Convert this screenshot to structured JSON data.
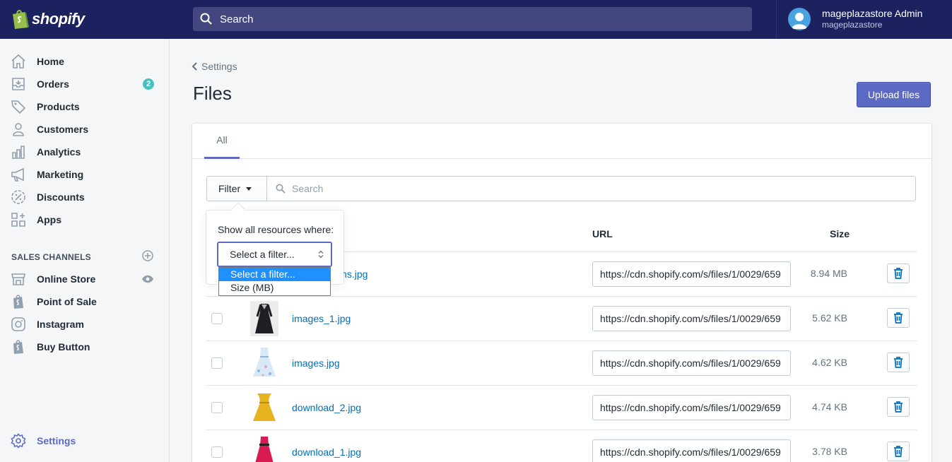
{
  "topbar": {
    "brand": "shopify",
    "search_placeholder": "Search",
    "user_name": "mageplazastore Admin",
    "store_name": "mageplazastore"
  },
  "sidebar": {
    "items": [
      {
        "label": "Home",
        "icon": "home-icon"
      },
      {
        "label": "Orders",
        "icon": "orders-icon",
        "badge": "2"
      },
      {
        "label": "Products",
        "icon": "tag-icon"
      },
      {
        "label": "Customers",
        "icon": "person-icon"
      },
      {
        "label": "Analytics",
        "icon": "bar-chart-icon"
      },
      {
        "label": "Marketing",
        "icon": "megaphone-icon"
      },
      {
        "label": "Discounts",
        "icon": "discount-icon"
      },
      {
        "label": "Apps",
        "icon": "apps-icon"
      }
    ],
    "sales_channels_heading": "SALES CHANNELS",
    "channels": [
      {
        "label": "Online Store",
        "icon": "store-icon"
      },
      {
        "label": "Point of Sale",
        "icon": "pos-bag-icon"
      },
      {
        "label": "Instagram",
        "icon": "instagram-icon"
      },
      {
        "label": "Buy Button",
        "icon": "buy-button-bag-icon"
      }
    ],
    "settings_label": "Settings"
  },
  "main": {
    "breadcrumb": "Settings",
    "title": "Files",
    "upload_button": "Upload files",
    "tabs": [
      {
        "label": "All"
      }
    ],
    "filter_button": "Filter",
    "search_placeholder": "Search",
    "columns": {
      "url": "URL",
      "size": "Size"
    },
    "rows": [
      {
        "name": "-in-mountains.jpg",
        "url": "https://cdn.shopify.com/s/files/1/0029/659",
        "size": "8.94 MB"
      },
      {
        "name": "images_1.jpg",
        "url": "https://cdn.shopify.com/s/files/1/0029/659",
        "size": "5.62 KB"
      },
      {
        "name": "images.jpg",
        "url": "https://cdn.shopify.com/s/files/1/0029/659",
        "size": "4.62 KB"
      },
      {
        "name": "download_2.jpg",
        "url": "https://cdn.shopify.com/s/files/1/0029/659",
        "size": "4.74 KB"
      },
      {
        "name": "download_1.jpg",
        "url": "https://cdn.shopify.com/s/files/1/0029/659",
        "size": "3.78 KB"
      }
    ]
  },
  "filter_popover": {
    "label": "Show all resources where:",
    "select_value": "Select a filter...",
    "options": [
      "Select a filter...",
      "Size (MB)"
    ]
  },
  "colors": {
    "topbar": "#1c2260",
    "primary": "#5c6ac4",
    "link": "#006fbb",
    "badge": "#47c1bf",
    "dropdown_highlight": "#1e90ff"
  }
}
